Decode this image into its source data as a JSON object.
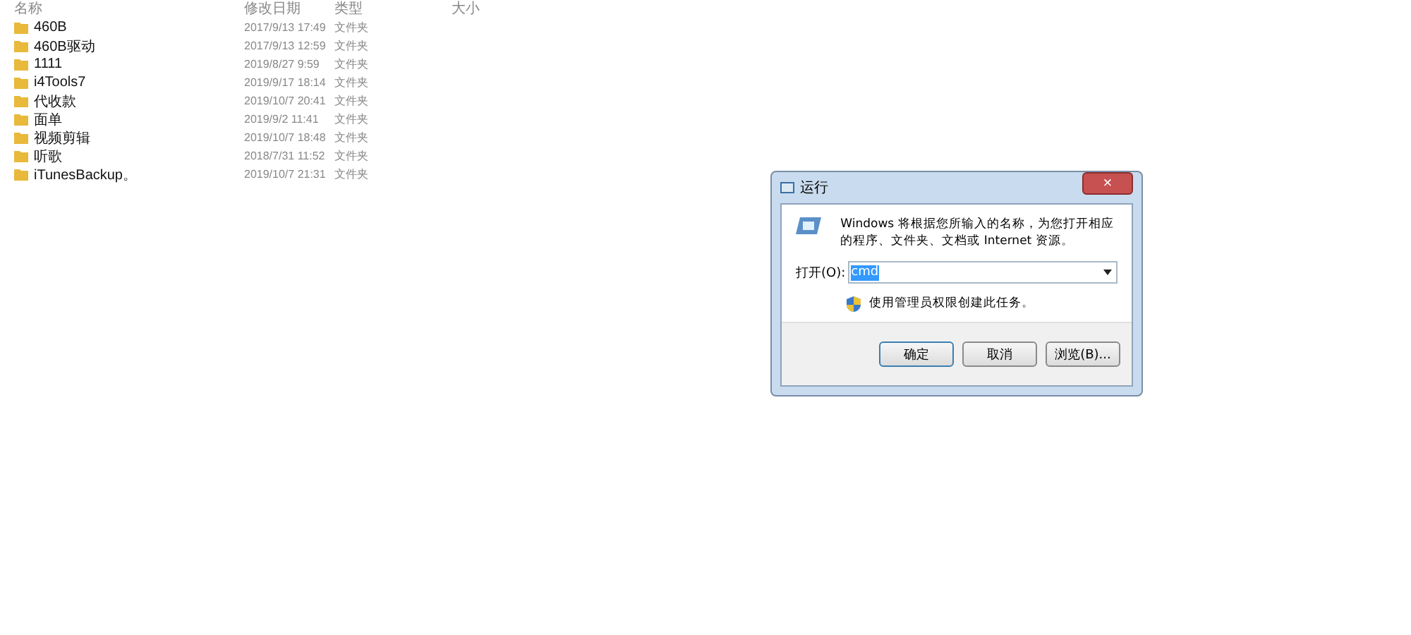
{
  "file_list": {
    "columns": [
      "名称",
      "修改日期",
      "类型",
      "大小"
    ],
    "rows": [
      {
        "name": "460B",
        "modified": "2017/9/13 17:49",
        "type": "文件夹"
      },
      {
        "name": "460B驱动",
        "modified": "2017/9/13 12:59",
        "type": "文件夹"
      },
      {
        "name": "1111",
        "modified": "2019/8/27 9:59",
        "type": "文件夹"
      },
      {
        "name": "i4Tools7",
        "modified": "2019/9/17 18:14",
        "type": "文件夹"
      },
      {
        "name": "代收款",
        "modified": "2019/10/7 20:41",
        "type": "文件夹"
      },
      {
        "name": "面单",
        "modified": "2019/9/2 11:41",
        "type": "文件夹"
      },
      {
        "name": "视频剪辑",
        "modified": "2019/10/7 18:48",
        "type": "文件夹"
      },
      {
        "name": "听歌",
        "modified": "2018/7/31 11:52",
        "type": "文件夹"
      },
      {
        "name": "iTunesBackup。",
        "modified": "2019/10/7 21:31",
        "type": "文件夹"
      }
    ]
  },
  "run_dialog": {
    "title": "运行",
    "close": "×",
    "description": "Windows 将根据您所输入的名称，为您打开相应的程序、文件夹、文档或 Internet 资源。",
    "open_label": "打开(O):",
    "open_value": "cmd",
    "admin_note": "使用管理员权限创建此任务。",
    "buttons": [
      "确定",
      "取消",
      "浏览(B)..."
    ]
  }
}
